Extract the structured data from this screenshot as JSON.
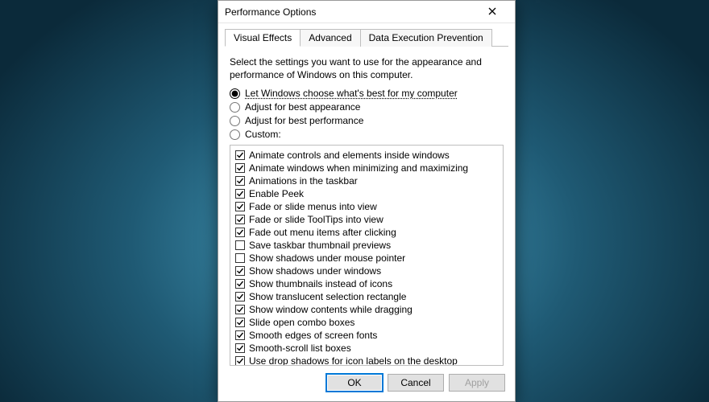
{
  "dialog": {
    "title": "Performance Options",
    "description": "Select the settings you want to use for the appearance and performance of Windows on this computer."
  },
  "tabs": [
    {
      "label": "Visual Effects",
      "active": true
    },
    {
      "label": "Advanced",
      "active": false
    },
    {
      "label": "Data Execution Prevention",
      "active": false
    }
  ],
  "radios": [
    {
      "label": "Let Windows choose what's best for my computer",
      "selected": true
    },
    {
      "label": "Adjust for best appearance",
      "selected": false
    },
    {
      "label": "Adjust for best performance",
      "selected": false
    },
    {
      "label": "Custom:",
      "selected": false
    }
  ],
  "effects": [
    {
      "label": "Animate controls and elements inside windows",
      "checked": true
    },
    {
      "label": "Animate windows when minimizing and maximizing",
      "checked": true
    },
    {
      "label": "Animations in the taskbar",
      "checked": true
    },
    {
      "label": "Enable Peek",
      "checked": true
    },
    {
      "label": "Fade or slide menus into view",
      "checked": true
    },
    {
      "label": "Fade or slide ToolTips into view",
      "checked": true
    },
    {
      "label": "Fade out menu items after clicking",
      "checked": true
    },
    {
      "label": "Save taskbar thumbnail previews",
      "checked": false
    },
    {
      "label": "Show shadows under mouse pointer",
      "checked": false
    },
    {
      "label": "Show shadows under windows",
      "checked": true
    },
    {
      "label": "Show thumbnails instead of icons",
      "checked": true
    },
    {
      "label": "Show translucent selection rectangle",
      "checked": true
    },
    {
      "label": "Show window contents while dragging",
      "checked": true
    },
    {
      "label": "Slide open combo boxes",
      "checked": true
    },
    {
      "label": "Smooth edges of screen fonts",
      "checked": true
    },
    {
      "label": "Smooth-scroll list boxes",
      "checked": true
    },
    {
      "label": "Use drop shadows for icon labels on the desktop",
      "checked": true
    }
  ],
  "buttons": {
    "ok": "OK",
    "cancel": "Cancel",
    "apply": "Apply"
  }
}
